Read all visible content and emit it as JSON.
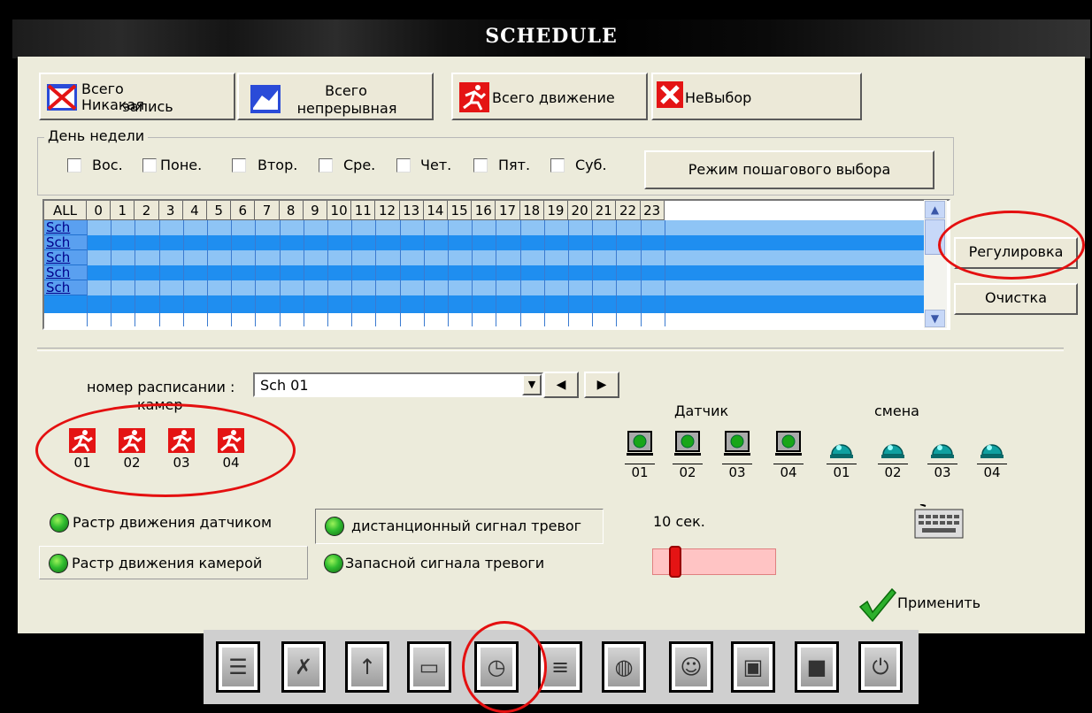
{
  "window": {
    "title": "SCHEDULE"
  },
  "top_buttons": {
    "no_record": {
      "line1": "Всего Никакая",
      "line2": "запись",
      "icon": "no-record-icon"
    },
    "continuous": {
      "line1": "Всего",
      "line2": "непрерывная",
      "icon": "continuous-record-icon"
    },
    "motion": {
      "label": "Всего движение",
      "icon": "motion-icon"
    },
    "deselect": {
      "label": "НеВыбор",
      "icon": "red-x-icon"
    }
  },
  "weekday_group": {
    "legend": "День недели",
    "days": [
      "Вос.",
      "Поне.",
      "Втор.",
      "Сре.",
      "Чет.",
      "Пят.",
      "Суб."
    ],
    "step_mode_button": "Режим пошагового выбора"
  },
  "schedule_grid": {
    "corner": "ALL",
    "hours": [
      "0",
      "1",
      "2",
      "3",
      "4",
      "5",
      "6",
      "7",
      "8",
      "9",
      "10",
      "11",
      "12",
      "13",
      "14",
      "15",
      "16",
      "17",
      "18",
      "19",
      "20",
      "21",
      "22",
      "23"
    ],
    "rows": [
      "Sch 01",
      "Sch 02",
      "Sch 03",
      "Sch 04",
      "Sch 05"
    ],
    "row_colors": [
      "#8ec4f5",
      "#1f8ef0"
    ]
  },
  "side_buttons": {
    "adjust": "Регулировка",
    "clear": "Очистка"
  },
  "schedule_number": {
    "label": "номер расписании :",
    "value": "Sch 01"
  },
  "cameras": {
    "label": "камер",
    "items": [
      "01",
      "02",
      "03",
      "04"
    ]
  },
  "sensor": {
    "label": "Датчик",
    "items": [
      "01",
      "02",
      "03",
      "04"
    ]
  },
  "shift": {
    "label": "смена",
    "items": [
      "01",
      "02",
      "03",
      "04"
    ]
  },
  "options": {
    "sensor_motion": "Растр движения датчиком",
    "camera_motion": "Растр движения камерой",
    "remote_alarm": "дистанционный сигнал тревог",
    "backup_alarm": "Запасной сигнала тревоги"
  },
  "duration": {
    "value": "10 сек."
  },
  "apply_button": "Применить",
  "toolbar_icons": [
    "settings-icon",
    "motion-record-icon",
    "network-icon",
    "disk-icon",
    "schedule-clock-icon",
    "list-icon",
    "globe-network-icon",
    "user-icon",
    "monitor-icon",
    "camera-icon",
    "power-icon"
  ],
  "colors": {
    "accent_red": "#e41414",
    "highlight_ring": "#e41010",
    "grid_blue": "#1f8ef0",
    "panel_bg": "#ecebdb"
  }
}
